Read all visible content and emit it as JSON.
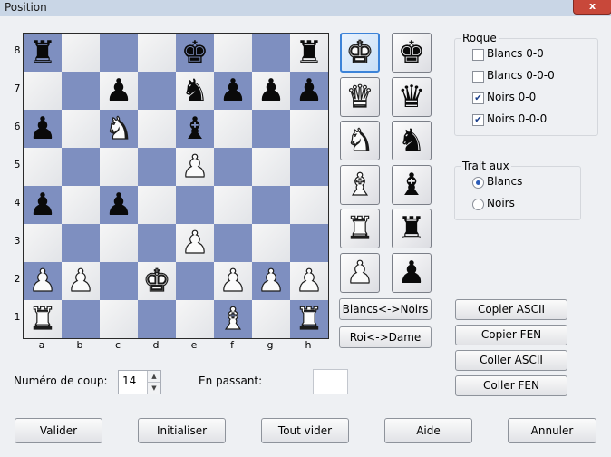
{
  "window": {
    "title": "Position",
    "close_label": "x"
  },
  "board": {
    "ranks": [
      "8",
      "7",
      "6",
      "5",
      "4",
      "3",
      "2",
      "1"
    ],
    "files": [
      "a",
      "b",
      "c",
      "d",
      "e",
      "f",
      "g",
      "h"
    ],
    "pieces": [
      {
        "square": "a8",
        "glyph": "♜",
        "color": "black",
        "name": "black-rook"
      },
      {
        "square": "e8",
        "glyph": "♚",
        "color": "black",
        "name": "black-king"
      },
      {
        "square": "h8",
        "glyph": "♜",
        "color": "black",
        "name": "black-rook"
      },
      {
        "square": "c7",
        "glyph": "♟",
        "color": "black",
        "name": "black-pawn"
      },
      {
        "square": "e7",
        "glyph": "♞",
        "color": "black",
        "name": "black-knight"
      },
      {
        "square": "f7",
        "glyph": "♟",
        "color": "black",
        "name": "black-pawn"
      },
      {
        "square": "g7",
        "glyph": "♟",
        "color": "black",
        "name": "black-pawn"
      },
      {
        "square": "h7",
        "glyph": "♟",
        "color": "black",
        "name": "black-pawn"
      },
      {
        "square": "a6",
        "glyph": "♟",
        "color": "black",
        "name": "black-pawn"
      },
      {
        "square": "c6",
        "glyph": "♞",
        "color": "white",
        "name": "white-knight"
      },
      {
        "square": "e6",
        "glyph": "♝",
        "color": "black",
        "name": "black-bishop"
      },
      {
        "square": "e5",
        "glyph": "♟",
        "color": "white",
        "name": "white-pawn"
      },
      {
        "square": "a4",
        "glyph": "♟",
        "color": "black",
        "name": "black-pawn"
      },
      {
        "square": "c4",
        "glyph": "♟",
        "color": "black",
        "name": "black-pawn"
      },
      {
        "square": "e3",
        "glyph": "♟",
        "color": "white",
        "name": "white-pawn"
      },
      {
        "square": "a2",
        "glyph": "♟",
        "color": "white",
        "name": "white-pawn"
      },
      {
        "square": "b2",
        "glyph": "♟",
        "color": "white",
        "name": "white-pawn"
      },
      {
        "square": "d2",
        "glyph": "♚",
        "color": "white",
        "name": "white-king"
      },
      {
        "square": "f2",
        "glyph": "♟",
        "color": "white",
        "name": "white-pawn"
      },
      {
        "square": "g2",
        "glyph": "♟",
        "color": "white",
        "name": "white-pawn"
      },
      {
        "square": "h2",
        "glyph": "♟",
        "color": "white",
        "name": "white-pawn"
      },
      {
        "square": "a1",
        "glyph": "♜",
        "color": "white",
        "name": "white-rook"
      },
      {
        "square": "f1",
        "glyph": "♝",
        "color": "white",
        "name": "white-bishop"
      },
      {
        "square": "h1",
        "glyph": "♜",
        "color": "white",
        "name": "white-rook"
      }
    ],
    "colors": {
      "light": "#eeeff2",
      "dark": "#7e8fc0"
    }
  },
  "palette": {
    "white": [
      {
        "glyph": "♚",
        "name": "white-king-tool",
        "selected": true
      },
      {
        "glyph": "♛",
        "name": "white-queen-tool"
      },
      {
        "glyph": "♞",
        "name": "white-knight-tool"
      },
      {
        "glyph": "♝",
        "name": "white-bishop-tool"
      },
      {
        "glyph": "♜",
        "name": "white-rook-tool"
      },
      {
        "glyph": "♟",
        "name": "white-pawn-tool"
      }
    ],
    "black": [
      {
        "glyph": "♚",
        "name": "black-king-tool"
      },
      {
        "glyph": "♛",
        "name": "black-queen-tool"
      },
      {
        "glyph": "♞",
        "name": "black-knight-tool"
      },
      {
        "glyph": "♝",
        "name": "black-bishop-tool"
      },
      {
        "glyph": "♜",
        "name": "black-rook-tool"
      },
      {
        "glyph": "♟",
        "name": "black-pawn-tool"
      }
    ]
  },
  "swap_colors_label": "Blancs<->Noirs",
  "swap_king_queen_label": "Roi<->Dame",
  "castling": {
    "title": "Roque",
    "white_short": {
      "label": "Blancs 0-0",
      "checked": false
    },
    "white_long": {
      "label": "Blancs 0-0-0",
      "checked": false
    },
    "black_short": {
      "label": "Noirs 0-0",
      "checked": true
    },
    "black_long": {
      "label": "Noirs 0-0-0",
      "checked": true
    }
  },
  "turn": {
    "title": "Trait aux",
    "white": {
      "label": "Blancs",
      "selected": true
    },
    "black": {
      "label": "Noirs",
      "selected": false
    }
  },
  "copy_buttons": {
    "copy_ascii": "Copier ASCII",
    "copy_fen": "Copier FEN",
    "paste_ascii": "Coller ASCII",
    "paste_fen": "Coller FEN"
  },
  "move_number": {
    "label": "Numéro de coup:",
    "value": "14"
  },
  "en_passant": {
    "label": "En passant:",
    "value": ""
  },
  "footer": {
    "validate": "Valider",
    "initialize": "Initialiser",
    "clear_all": "Tout vider",
    "help": "Aide",
    "cancel": "Annuler"
  }
}
